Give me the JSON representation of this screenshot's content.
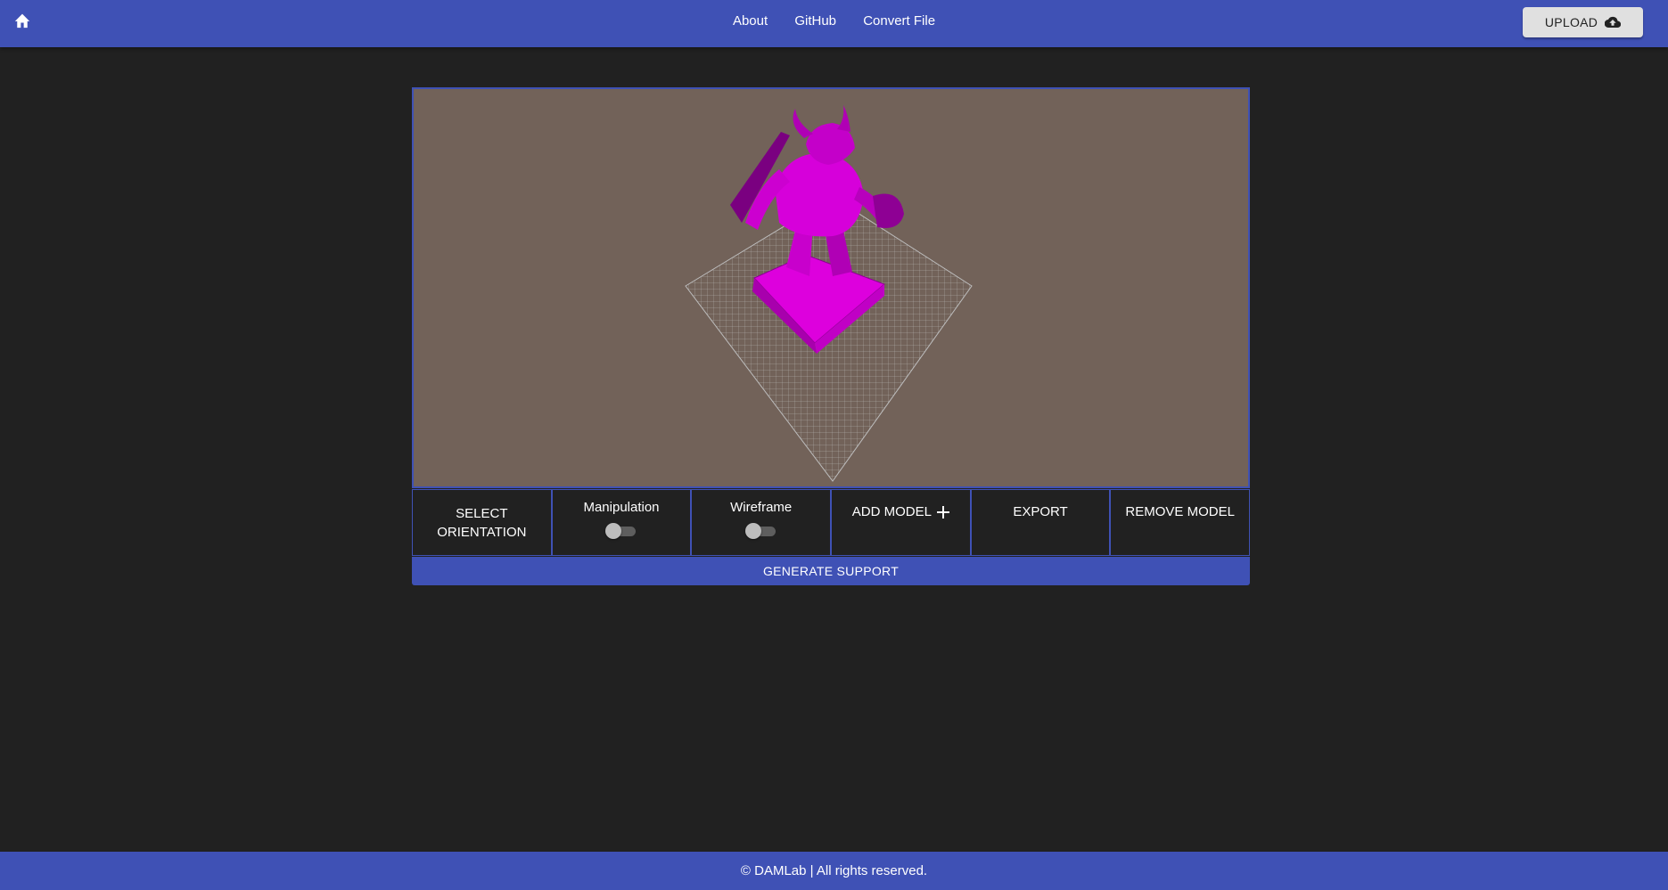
{
  "header": {
    "home_icon": "home-icon",
    "nav": [
      {
        "label": "About"
      },
      {
        "label": "GitHub"
      },
      {
        "label": "Convert File"
      }
    ],
    "upload_label": "UPLOAD",
    "upload_icon": "cloud-upload-icon"
  },
  "viewer": {
    "background_color": "#726259",
    "model_color": "#e100e6"
  },
  "controls": {
    "select_orientation_line1": "SELECT",
    "select_orientation_line2": "ORIENTATION",
    "manipulation_label": "Manipulation",
    "manipulation_on": false,
    "wireframe_label": "Wireframe",
    "wireframe_on": false,
    "add_model_label": "ADD MODEL",
    "export_label": "EXPORT",
    "remove_model_label": "REMOVE MODEL",
    "generate_support_label": "GENERATE SUPPORT"
  },
  "footer": {
    "text": "© DAMLab | All rights reserved."
  },
  "colors": {
    "primary": "#3f51b5",
    "page_bg": "#212121",
    "upload_bg": "#e0e0e0"
  }
}
